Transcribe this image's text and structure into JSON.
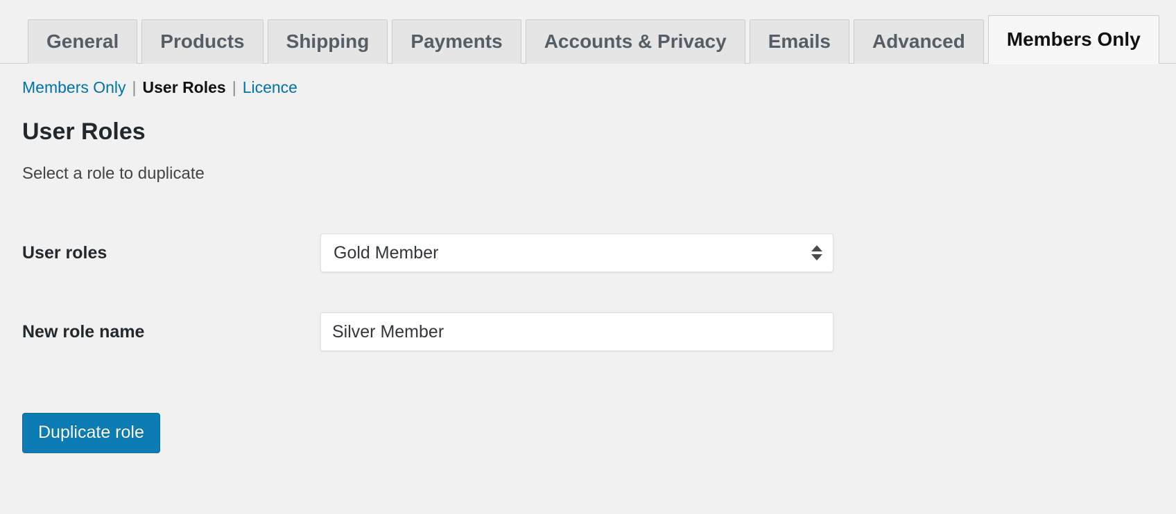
{
  "tabs": [
    {
      "label": "General",
      "active": false
    },
    {
      "label": "Products",
      "active": false
    },
    {
      "label": "Shipping",
      "active": false
    },
    {
      "label": "Payments",
      "active": false
    },
    {
      "label": "Accounts & Privacy",
      "active": false
    },
    {
      "label": "Emails",
      "active": false
    },
    {
      "label": "Advanced",
      "active": false
    },
    {
      "label": "Members Only",
      "active": true
    }
  ],
  "subnav": {
    "items": [
      {
        "label": "Members Only",
        "current": false
      },
      {
        "label": "User Roles",
        "current": true
      },
      {
        "label": "Licence",
        "current": false
      }
    ],
    "separator": "|"
  },
  "page": {
    "title": "User Roles",
    "description": "Select a role to duplicate"
  },
  "form": {
    "user_roles": {
      "label": "User roles",
      "selected": "Gold Member",
      "options": [
        "Gold Member"
      ]
    },
    "new_role_name": {
      "label": "New role name",
      "value": "Silver Member",
      "placeholder": ""
    }
  },
  "submit": {
    "label": "Duplicate role"
  },
  "colors": {
    "link": "#0073aa",
    "button_primary": "#0c7cb4",
    "page_background": "#f1f1f1",
    "tab_inactive": "#e5e5e5",
    "tab_active": "#f7f7f7"
  },
  "icons": {
    "select_arrows": "sort-arrows-icon"
  }
}
